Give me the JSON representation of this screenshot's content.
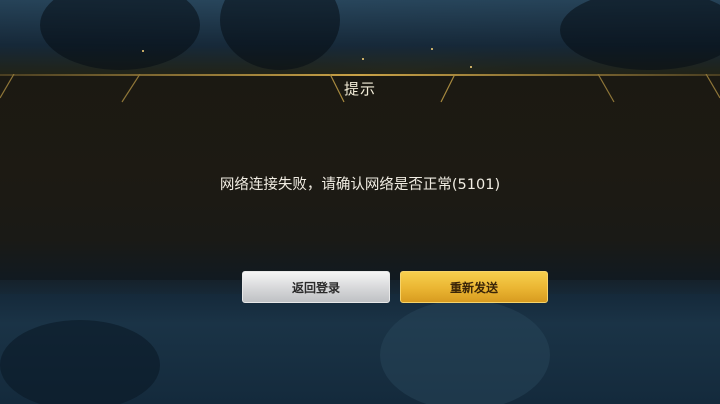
{
  "dialog": {
    "title": "提示",
    "message": "网络连接失败，请确认网络是否正常(5101)"
  },
  "buttons": {
    "back_login": "返回登录",
    "resend": "重新发送"
  },
  "colors": {
    "panel": "#1b1912",
    "accent_gold": "#c9a247",
    "primary_button": "#eab532",
    "secondary_button": "#d6d7d9"
  }
}
